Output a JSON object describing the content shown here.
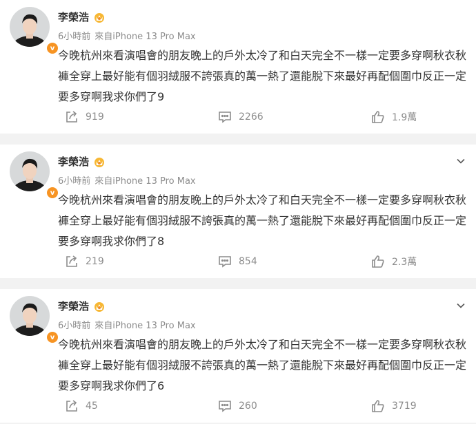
{
  "colors": {
    "background": "#f2f2f2",
    "card": "#ffffff",
    "text": "#333333",
    "muted": "#8c8c8c",
    "badge": "#f79423"
  },
  "posts": [
    {
      "author": "李榮浩",
      "time": "6小時前",
      "source": "來自iPhone 13 Pro Max",
      "text": "今晚杭州來看演唱會的朋友晚上的戶外太冷了和白天完全不一樣一定要多穿啊秋衣秋褲全穿上最好能有個羽絨服不誇張真的萬一熱了還能脫下來最好再配個圍巾反正一定要多穿啊我求你們了9",
      "reposts": "919",
      "comments": "2266",
      "likes": "1.9萬",
      "show_menu": false
    },
    {
      "author": "李榮浩",
      "time": "6小時前",
      "source": "來自iPhone 13 Pro Max",
      "text": "今晚杭州來看演唱會的朋友晚上的戶外太冷了和白天完全不一樣一定要多穿啊秋衣秋褲全穿上最好能有個羽絨服不誇張真的萬一熱了還能脫下來最好再配個圍巾反正一定要多穿啊我求你們了8",
      "reposts": "219",
      "comments": "854",
      "likes": "2.3萬",
      "show_menu": true
    },
    {
      "author": "李榮浩",
      "time": "6小時前",
      "source": "來自iPhone 13 Pro Max",
      "text": "今晚杭州來看演唱會的朋友晚上的戶外太冷了和白天完全不一樣一定要多穿啊秋衣秋褲全穿上最好能有個羽絨服不誇張真的萬一熱了還能脫下來最好再配個圍巾反正一定要多穿啊我求你們了6",
      "reposts": "45",
      "comments": "260",
      "likes": "3719",
      "show_menu": true
    }
  ]
}
